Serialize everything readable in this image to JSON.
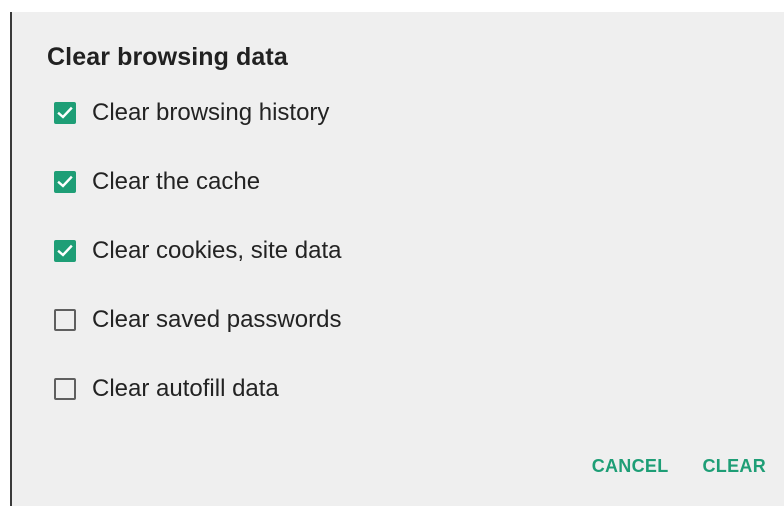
{
  "dialog": {
    "title": "Clear browsing data",
    "options": [
      {
        "label": "Clear browsing history",
        "checked": true
      },
      {
        "label": "Clear the cache",
        "checked": true
      },
      {
        "label": "Clear cookies, site data",
        "checked": true
      },
      {
        "label": "Clear saved passwords",
        "checked": false
      },
      {
        "label": "Clear autofill data",
        "checked": false
      }
    ],
    "cancel_label": "CANCEL",
    "clear_label": "CLEAR"
  },
  "colors": {
    "accent": "#1e9e76",
    "dialog_background": "#efefef",
    "text": "#232323"
  },
  "icons": {
    "checked": "checkbox-checked-icon",
    "unchecked": "checkbox-unchecked-icon"
  }
}
